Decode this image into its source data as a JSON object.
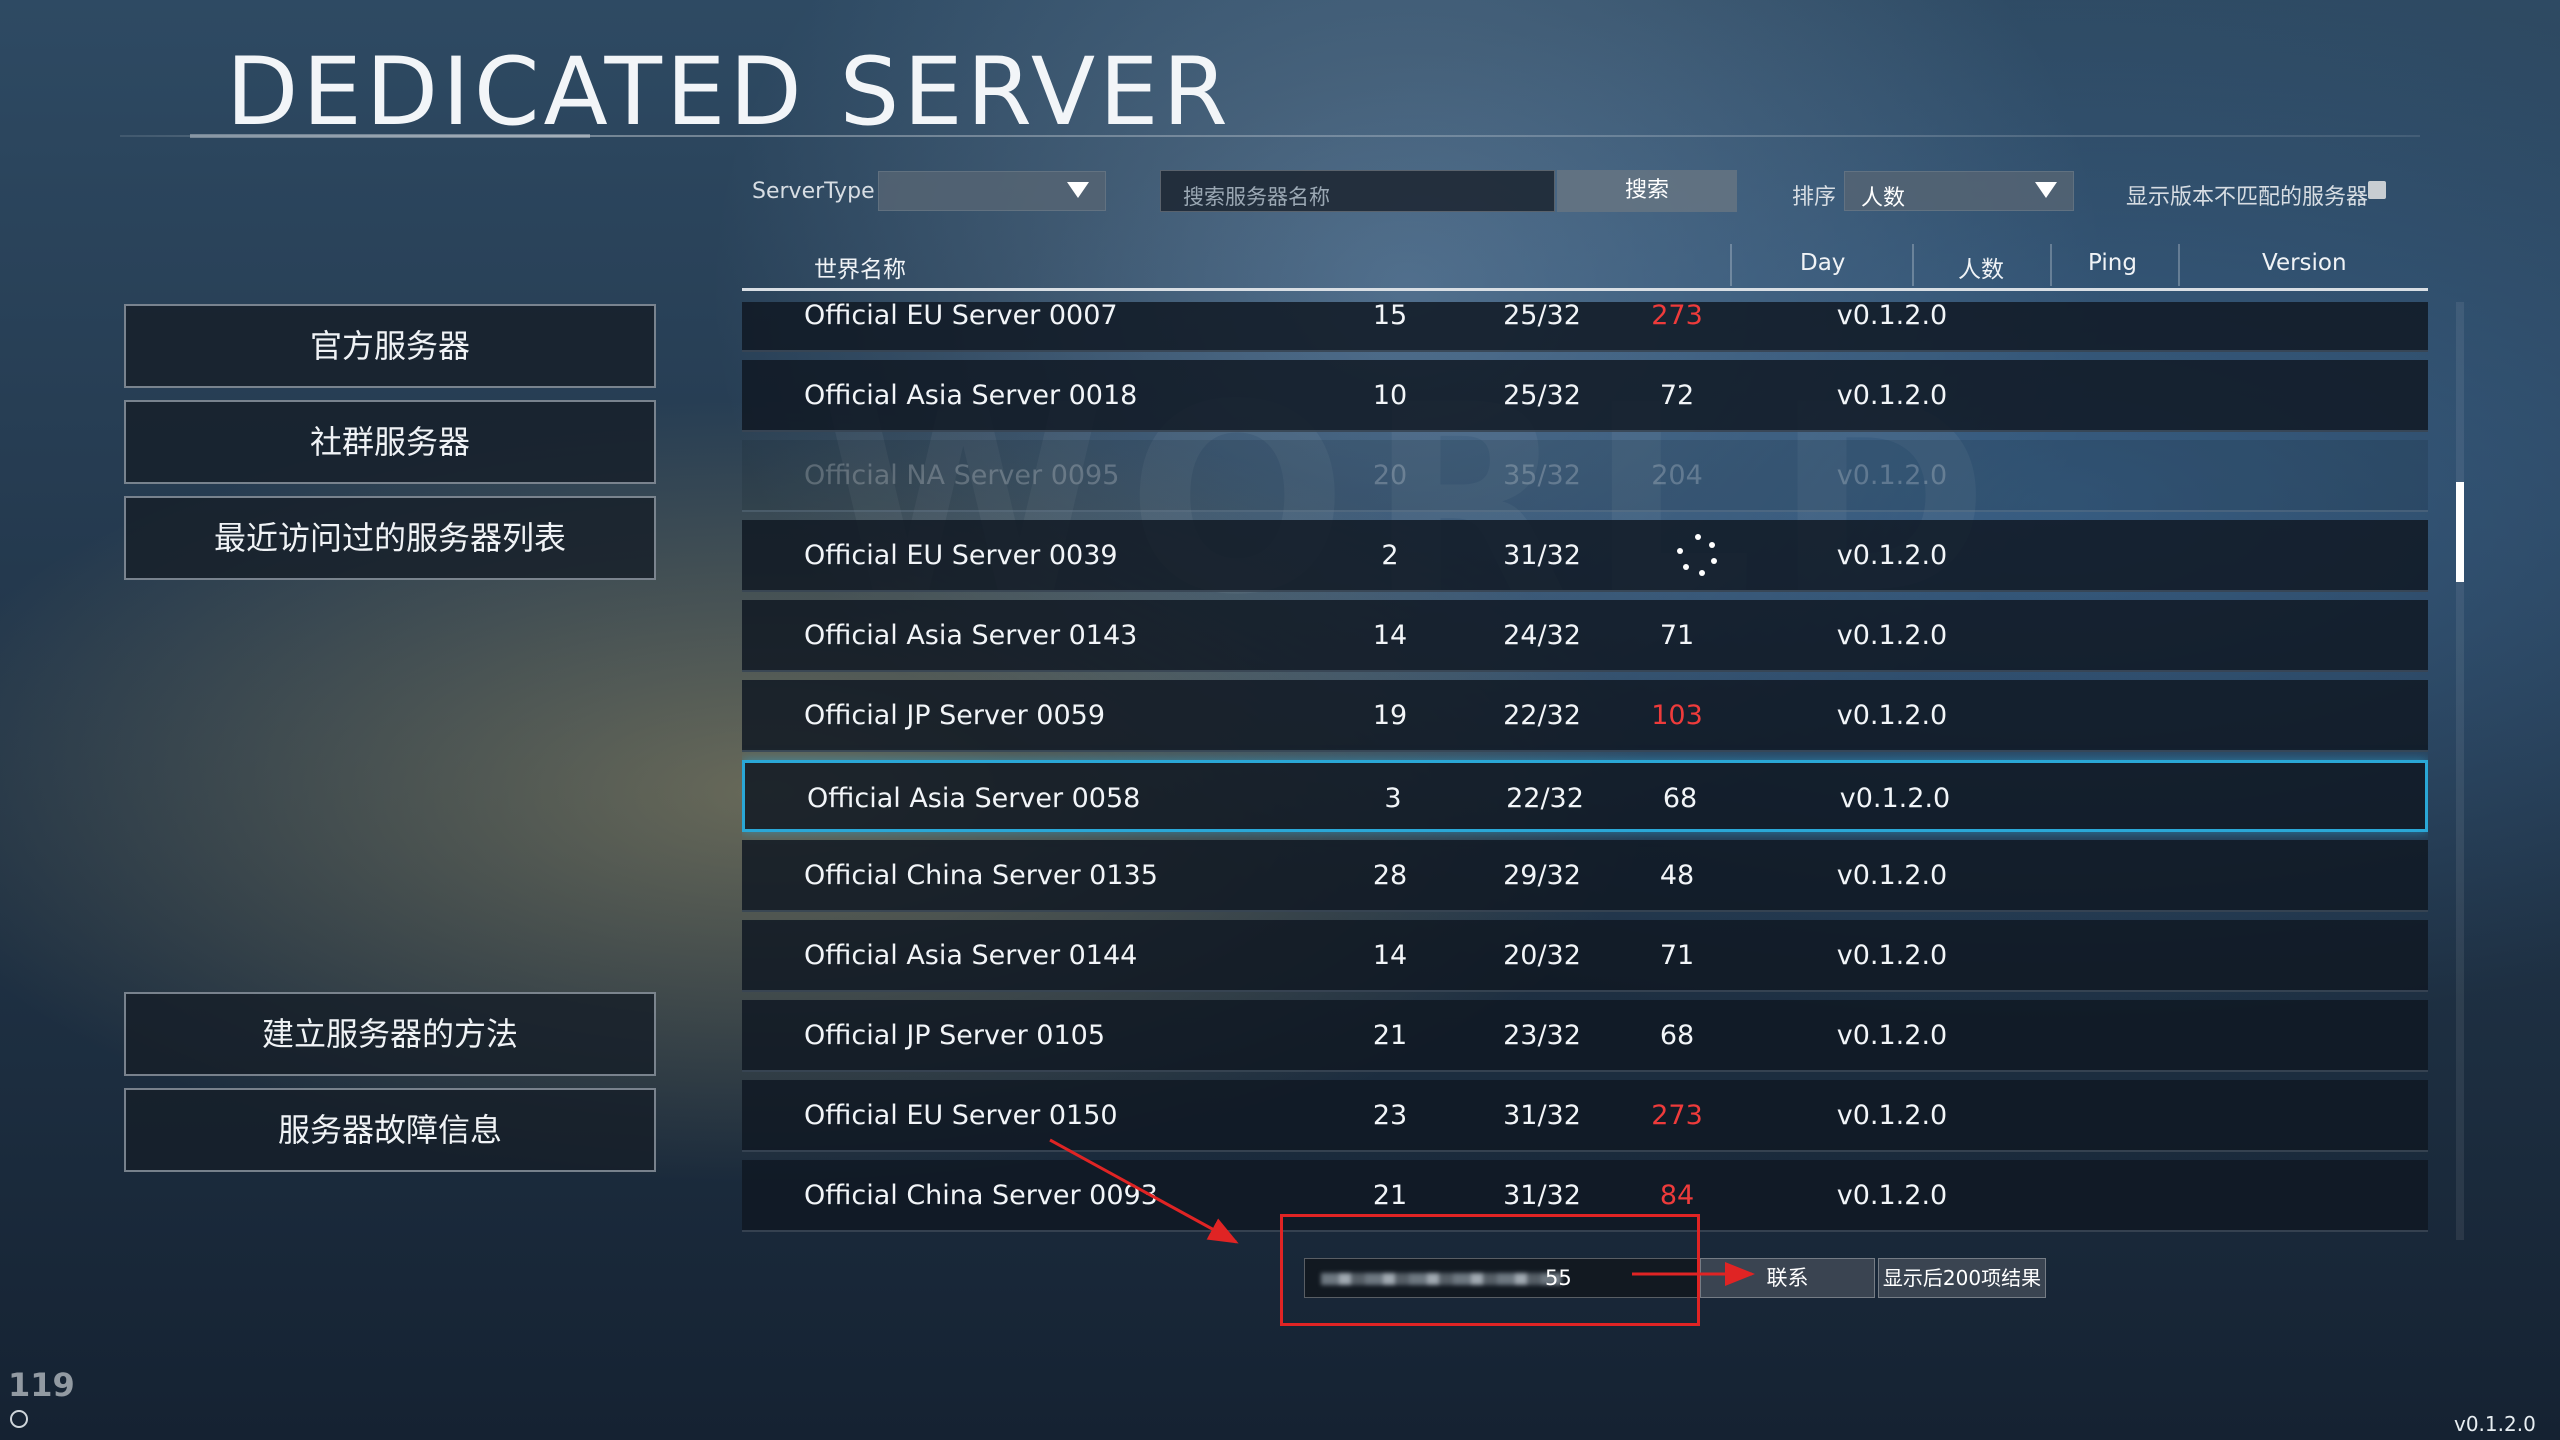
{
  "title": "DEDICATED SERVER",
  "filters": {
    "server_type_label": "ServerType",
    "server_type_value": "",
    "search_placeholder": "搜索服务器名称",
    "search_button": "搜索",
    "sort_label": "排序",
    "sort_value": "人数",
    "mismatch_label": "显示版本不匹配的服务器",
    "mismatch_checked": false
  },
  "nav": {
    "official": "官方服务器",
    "community": "社群服务器",
    "recent": "最近访问过的服务器列表",
    "howto": "建立服务器的方法",
    "issues": "服务器故障信息"
  },
  "table": {
    "headers": {
      "name": "世界名称",
      "day": "Day",
      "players": "人数",
      "ping": "Ping",
      "version": "Version"
    },
    "rows": [
      {
        "name": "Official EU Server 0007",
        "day": "15",
        "players": "25/32",
        "ping": "273",
        "ping_high": true,
        "version": "v0.1.2.0",
        "state": "partial"
      },
      {
        "name": "Official Asia Server 0018",
        "day": "10",
        "players": "25/32",
        "ping": "72",
        "ping_high": false,
        "version": "v0.1.2.0",
        "state": "normal"
      },
      {
        "name": "Official NA Server 0095",
        "day": "20",
        "players": "35/32",
        "ping": "204",
        "ping_high": true,
        "version": "v0.1.2.0",
        "state": "dim"
      },
      {
        "name": "Official EU Server 0039",
        "day": "2",
        "players": "31/32",
        "ping": "",
        "ping_loading": true,
        "version": "v0.1.2.0",
        "state": "normal"
      },
      {
        "name": "Official Asia Server 0143",
        "day": "14",
        "players": "24/32",
        "ping": "71",
        "ping_high": false,
        "version": "v0.1.2.0",
        "state": "normal"
      },
      {
        "name": "Official JP Server 0059",
        "day": "19",
        "players": "22/32",
        "ping": "103",
        "ping_high": true,
        "version": "v0.1.2.0",
        "state": "normal"
      },
      {
        "name": "Official Asia Server 0058",
        "day": "3",
        "players": "22/32",
        "ping": "68",
        "ping_high": false,
        "version": "v0.1.2.0",
        "state": "selected"
      },
      {
        "name": "Official China Server 0135",
        "day": "28",
        "players": "29/32",
        "ping": "48",
        "ping_high": false,
        "version": "v0.1.2.0",
        "state": "normal"
      },
      {
        "name": "Official Asia Server 0144",
        "day": "14",
        "players": "20/32",
        "ping": "71",
        "ping_high": false,
        "version": "v0.1.2.0",
        "state": "normal"
      },
      {
        "name": "Official JP Server 0105",
        "day": "21",
        "players": "23/32",
        "ping": "68",
        "ping_high": false,
        "version": "v0.1.2.0",
        "state": "normal"
      },
      {
        "name": "Official EU Server 0150",
        "day": "23",
        "players": "31/32",
        "ping": "273",
        "ping_high": true,
        "version": "v0.1.2.0",
        "state": "normal"
      },
      {
        "name": "Official China Server 0093",
        "day": "21",
        "players": "31/32",
        "ping": "84",
        "ping_high": true,
        "version": "v0.1.2.0",
        "state": "normal"
      }
    ]
  },
  "bottom": {
    "ip_tail": "55",
    "connect_button": "联系",
    "next_button": "显示后200项结果"
  },
  "colors": {
    "selected_border": "#2aa7d6",
    "ping_high": "#ee3b3b",
    "annotation": "#e02424"
  },
  "fps": "119",
  "version_corner": "v0.1.2.0",
  "watermark": "WORLD"
}
